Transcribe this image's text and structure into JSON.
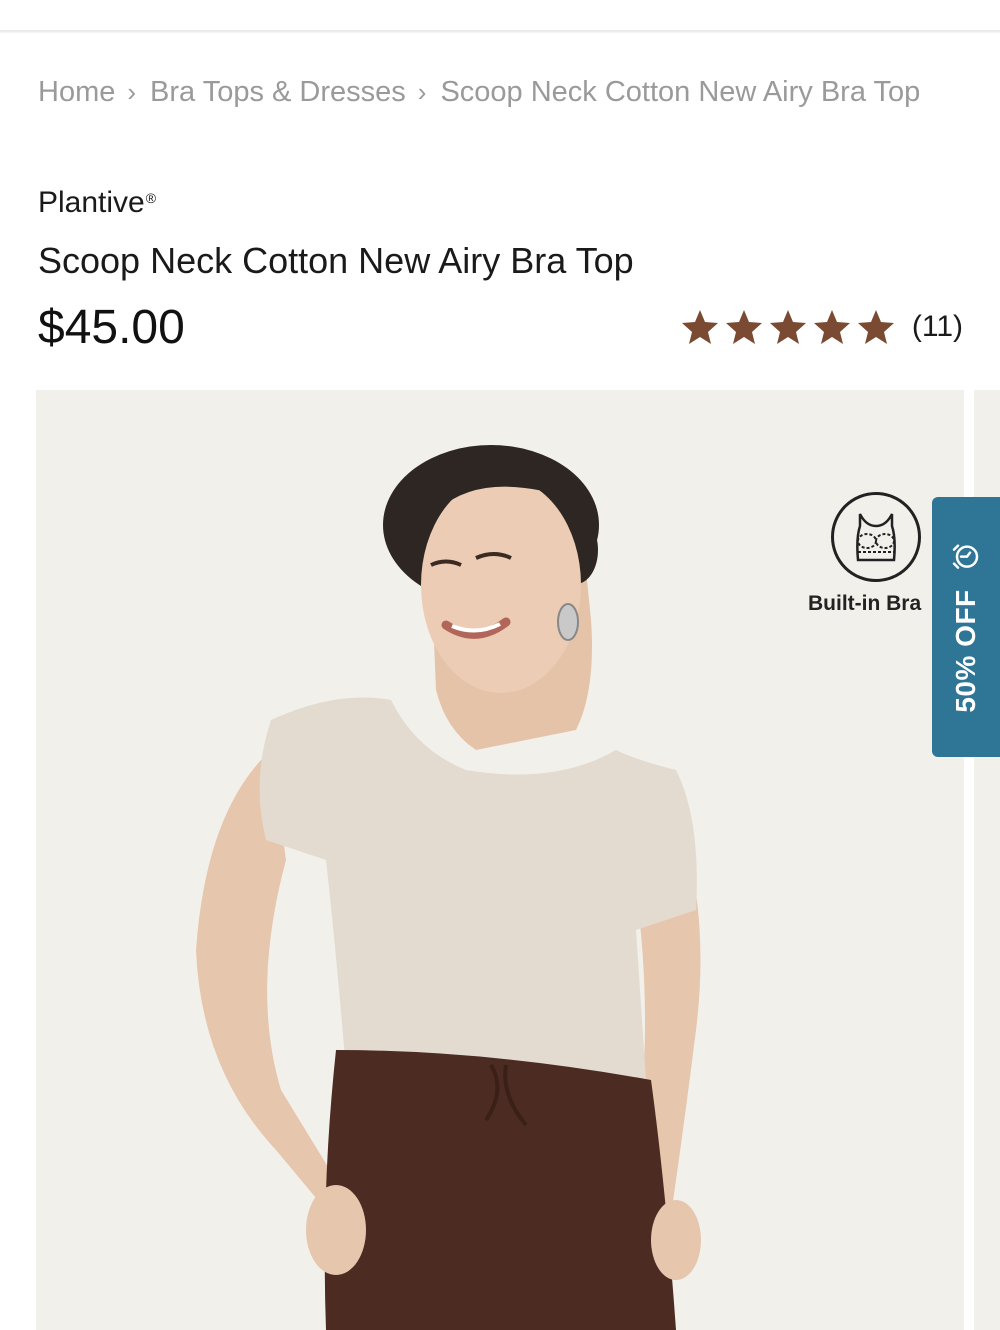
{
  "breadcrumb": {
    "items": [
      "Home",
      "Bra Tops & Dresses",
      "Scoop Neck Cotton New Airy Bra Top"
    ],
    "separator": ">"
  },
  "product": {
    "brand": "Plantive",
    "brand_mark": "®",
    "title": "Scoop Neck Cotton New Airy Bra Top",
    "price": "$45.00",
    "rating": {
      "stars": 5,
      "max_stars": 5,
      "count": "(11)",
      "star_color": "#7a4a32"
    }
  },
  "gallery": {
    "badge_label": "Built-in Bra",
    "badge_icon": "bra-icon"
  },
  "promo": {
    "text": "50% OFF",
    "icon": "alarm-clock-icon",
    "color": "#2e7596"
  }
}
